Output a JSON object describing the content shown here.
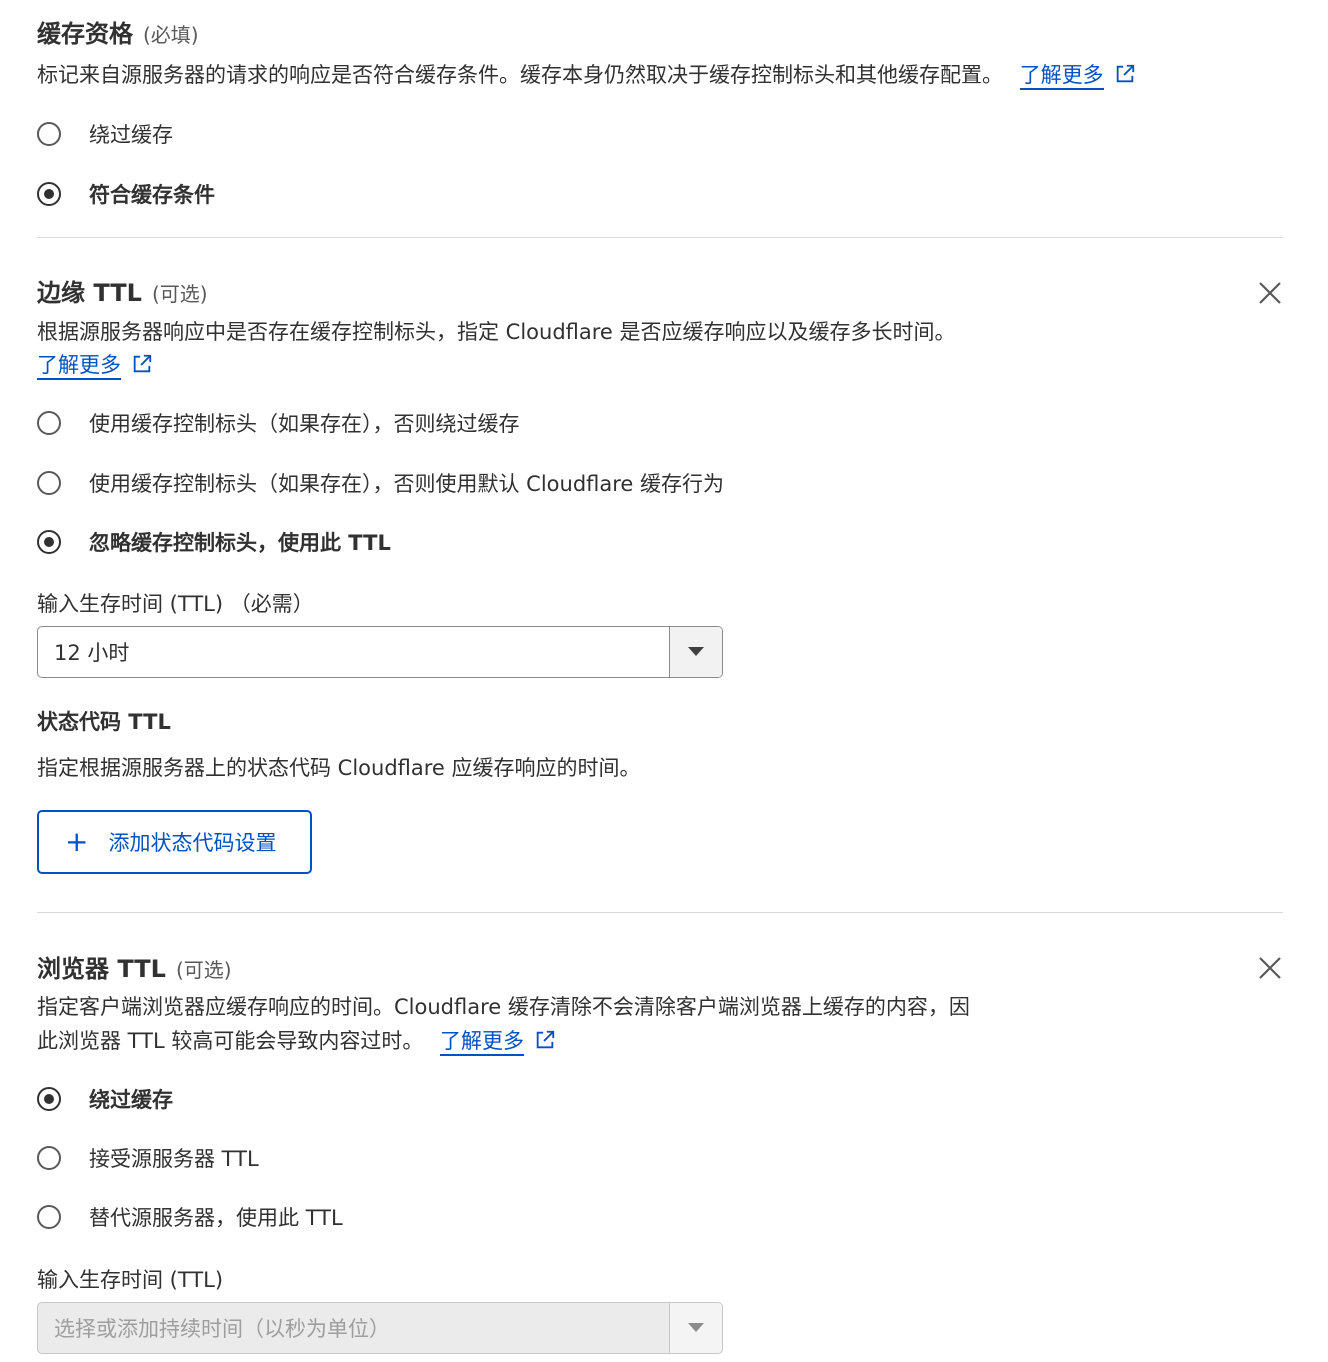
{
  "cache_eligibility": {
    "title": "缓存资格",
    "qualifier": "(必填)",
    "description": "标记来自源服务器的请求的响应是否符合缓存条件。缓存本身仍然取决于缓存控制标头和其他缓存配置。",
    "learn_more": "了解更多",
    "options": [
      {
        "label": "绕过缓存",
        "selected": false
      },
      {
        "label": "符合缓存条件",
        "selected": true
      }
    ]
  },
  "edge_ttl": {
    "title": "边缘 TTL",
    "qualifier": "(可选)",
    "description": "根据源服务器响应中是否存在缓存控制标头，指定 Cloudflare 是否应缓存响应以及缓存多长时间。",
    "learn_more": "了解更多",
    "options": [
      {
        "label": "使用缓存控制标头（如果存在），否则绕过缓存",
        "selected": false
      },
      {
        "label": "使用缓存控制标头（如果存在），否则使用默认 Cloudflare 缓存行为",
        "selected": false
      },
      {
        "label": "忽略缓存控制标头，使用此 TTL",
        "selected": true
      }
    ],
    "ttl_label": "输入生存时间 (TTL) （必需）",
    "ttl_value": "12 小时",
    "status_code_title": "状态代码 TTL",
    "status_code_description": "指定根据源服务器上的状态代码 Cloudflare 应缓存响应的时间。",
    "add_button": "添加状态代码设置"
  },
  "browser_ttl": {
    "title": "浏览器 TTL",
    "qualifier": "(可选)",
    "description_line1": "指定客户端浏览器应缓存响应的时间。Cloudflare 缓存清除不会清除客户端浏览器上缓存的内容，因",
    "description_line2": "此浏览器 TTL 较高可能会导致内容过时。",
    "learn_more": "了解更多",
    "options": [
      {
        "label": "绕过缓存",
        "selected": true
      },
      {
        "label": "接受源服务器 TTL",
        "selected": false
      },
      {
        "label": "替代源服务器，使用此 TTL",
        "selected": false
      }
    ],
    "ttl_label": "输入生存时间 (TTL)",
    "ttl_placeholder": "选择或添加持续时间（以秒为单位）"
  },
  "colors": {
    "link": "#0051c3",
    "text": "#313131",
    "divider": "#d9d9d9"
  },
  "icons": [
    "external-link-icon",
    "close-icon",
    "chevron-down-icon",
    "plus-icon"
  ]
}
